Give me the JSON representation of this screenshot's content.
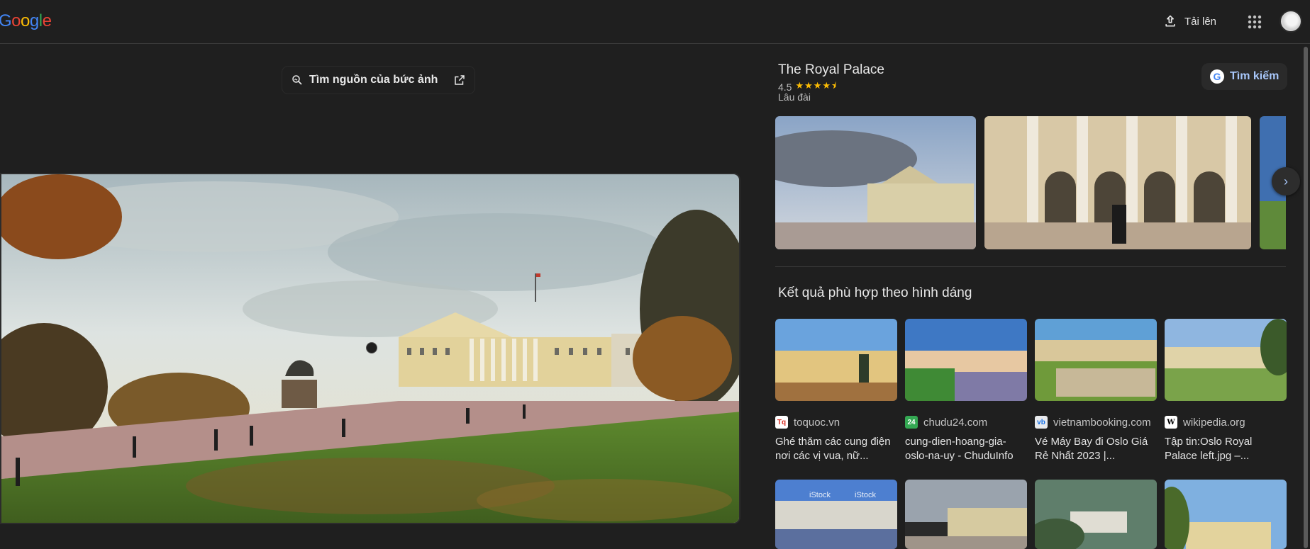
{
  "header": {
    "logo": [
      "G",
      "o",
      "o",
      "g",
      "l",
      "e"
    ],
    "upload_label": "Tải lên"
  },
  "lens": {
    "find_source_label": "Tìm nguồn của bức ảnh"
  },
  "knowledge": {
    "title": "The Royal Palace",
    "rating": "4.5",
    "stars": "★★★★⯨",
    "type": "Lâu đài",
    "search_label": "Tìm kiếm"
  },
  "visual_matches": {
    "title": "Kết quả phù hợp theo hình dáng",
    "results": [
      {
        "source": "toquoc.vn",
        "title": "Ghé thăm các cung điện nơi các vị vua, nữ...",
        "favicon": "Tq",
        "favicon_color": "#d93025"
      },
      {
        "source": "chudu24.com",
        "title": "cung-dien-hoang-gia-oslo-na-uy - ChuduInfo",
        "favicon": "24",
        "favicon_color": "#34a853"
      },
      {
        "source": "vietnambooking.com",
        "title": "Vé Máy Bay đi Oslo Giá Rẻ Nhất 2023 |...",
        "favicon": "vb",
        "favicon_color": "#e8eaed"
      },
      {
        "source": "wikipedia.org",
        "title": "Tập tin:Oslo Royal Palace left.jpg –...",
        "favicon": "W",
        "favicon_color": "#ffffff"
      }
    ],
    "watermark": "iStock"
  },
  "colors": {
    "background": "#1f1f1f",
    "accent": "#a8c7fa",
    "star": "#fbbc04"
  }
}
